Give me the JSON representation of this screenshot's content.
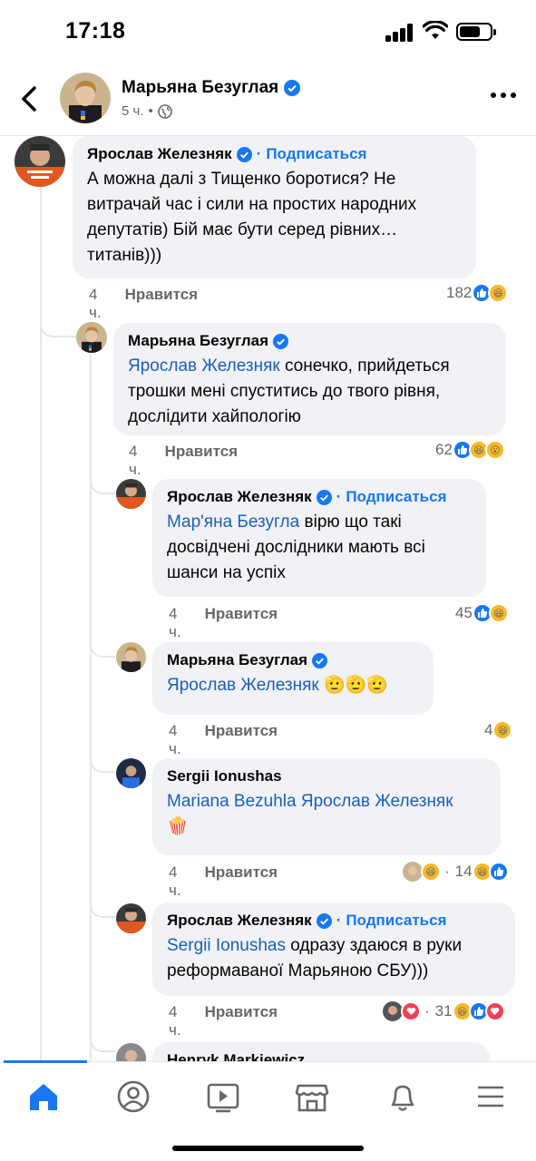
{
  "status_bar": {
    "time": "17:18"
  },
  "post_header": {
    "author": "Марьяна Безуглая",
    "time": "5 ч.",
    "separator": "•"
  },
  "comments": [
    {
      "author": "Ярослав Железняк",
      "follow": "Подписаться",
      "text": "А можна далі з Тищенко боротися? Не витрачай час і сили на простих народних депутатів) Бій має бути серед рівних… титанів)))",
      "time": "4 ч.",
      "like": "Нравится",
      "reactions_count": "182",
      "reactions": [
        "like",
        "haha"
      ]
    },
    {
      "author": "Марьяна Безуглая",
      "mention": "Ярослав Железняк",
      "text": " сонечко, прийдеться трошки мені спуститись до твого рівня, дослідити хайпологію",
      "time": "4 ч.",
      "like": "Нравится",
      "reactions_count": "62",
      "reactions": [
        "like",
        "haha",
        "wow"
      ]
    },
    {
      "author": "Ярослав Железняк",
      "follow": "Подписаться",
      "mention": "Мар'яна Безугла",
      "text": " вірю що такі досвідчені дослідники мають всі шанси на успіх",
      "time": "4 ч.",
      "like": "Нравится",
      "reactions_count": "45",
      "reactions": [
        "like",
        "haha"
      ]
    },
    {
      "author": "Марьяна Безуглая",
      "mention": "Ярослав Железняк",
      "text": " 🫡🫡🫡",
      "time": "4 ч.",
      "like": "Нравится",
      "reactions_count": "4",
      "reactions": [
        "haha"
      ]
    },
    {
      "author": "Sergii Ionushas",
      "mention": "Mariana Bezuhla Ярослав Железняк",
      "text": "🍿",
      "time": "4 ч.",
      "like": "Нравится",
      "reactions_count": "14",
      "reactions": [
        "haha",
        "like"
      ]
    },
    {
      "author": "Ярослав Железняк",
      "follow": "Подписаться",
      "mention": "Sergii Ionushas",
      "text": " одразу здаюся в руки реформаваної Марьяною СБУ)))",
      "time": "4 ч.",
      "like": "Нравится",
      "reactions_count": "31",
      "reactions": [
        "haha",
        "like",
        "love"
      ]
    },
    {
      "author": "Henryk Markiewicz"
    }
  ],
  "colors": {
    "accent": "#1877f2",
    "bubble": "#f0f2f5",
    "muted": "#65676b"
  },
  "nav": [
    "home-icon",
    "profile-icon",
    "video-icon",
    "marketplace-icon",
    "notifications-icon",
    "menu-icon"
  ]
}
